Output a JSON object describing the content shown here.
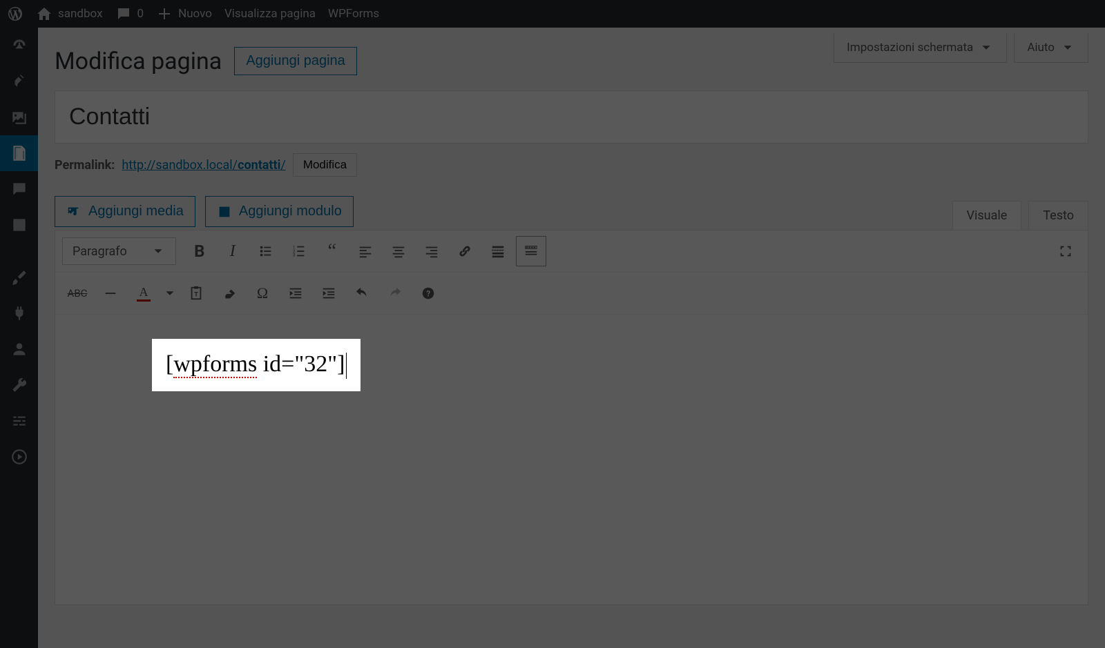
{
  "adminbar": {
    "site_name": "sandbox",
    "comments_count": "0",
    "new_label": "Nuovo",
    "view_page_label": "Visualizza pagina",
    "wpforms_label": "WPForms"
  },
  "sidebar_items": [
    {
      "icon": "dashboard"
    },
    {
      "icon": "pin"
    },
    {
      "icon": "media"
    },
    {
      "icon": "pages",
      "active": true
    },
    {
      "icon": "comments"
    },
    {
      "icon": "form"
    },
    {
      "icon": "sep"
    },
    {
      "icon": "appearance"
    },
    {
      "icon": "plugins"
    },
    {
      "icon": "users"
    },
    {
      "icon": "tools"
    },
    {
      "icon": "settings"
    },
    {
      "icon": "play"
    }
  ],
  "screen_options": {
    "label": "Impostazioni schermata",
    "help_label": "Aiuto"
  },
  "header": {
    "title": "Modifica pagina",
    "add_new": "Aggiungi pagina"
  },
  "title_field": {
    "value": "Contatti"
  },
  "permalink": {
    "label": "Permalink:",
    "url": "http://sandbox.local/",
    "slug": "contatti",
    "trail": "/",
    "edit": "Modifica"
  },
  "media_buttons": {
    "add_media": "Aggiungi media",
    "add_form": "Aggiungi modulo"
  },
  "editor_tabs": {
    "visual": "Visuale",
    "text": "Testo"
  },
  "toolbar": {
    "format_select": "Paragrafo"
  },
  "editor_content": {
    "pre": "[",
    "spell": "wpforms",
    "post": " id=\"32\"]"
  }
}
